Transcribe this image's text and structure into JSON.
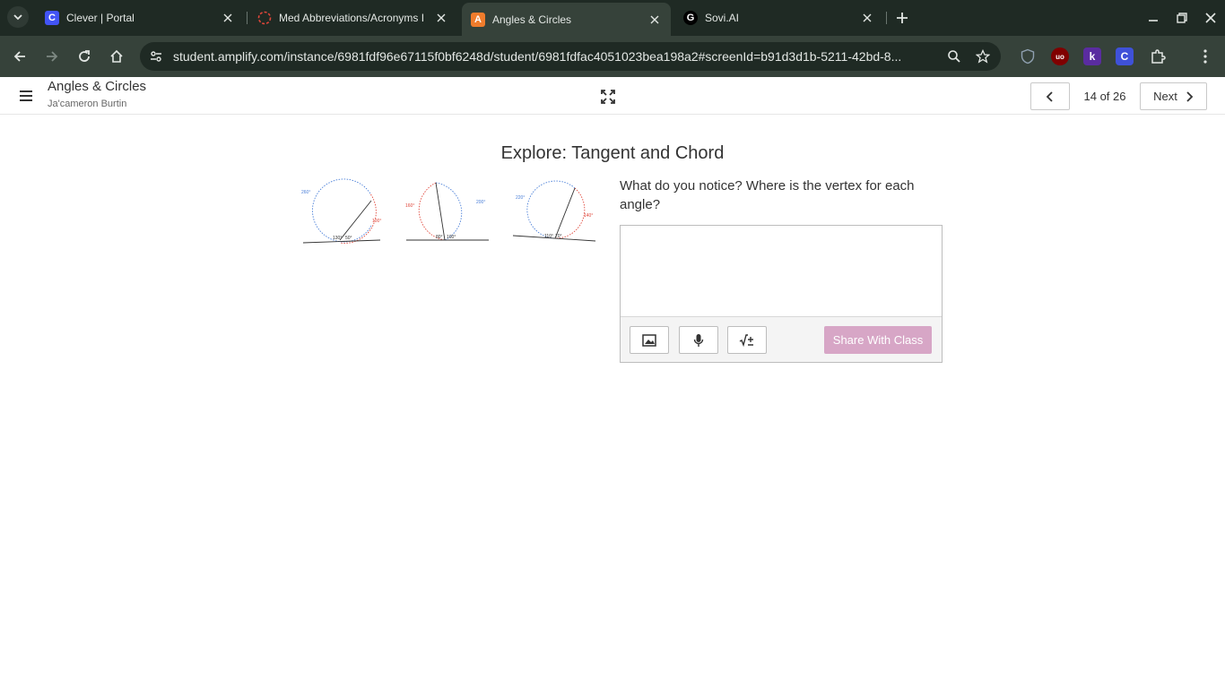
{
  "browser": {
    "tabs": [
      {
        "title": "Clever | Portal",
        "favicon": "clever-icon",
        "favicon_color": "#4254f5"
      },
      {
        "title": "Med Abbreviations/Acronyms I",
        "favicon": "loading-spinner-icon",
        "favicon_color": "#e0463a"
      },
      {
        "title": "Angles & Circles",
        "favicon": "amplify-icon",
        "favicon_color": "#f07c2c",
        "active": true
      },
      {
        "title": "Sovi.AI",
        "favicon": "sovi-icon",
        "favicon_color": "#ffffff"
      }
    ],
    "url": "student.amplify.com/instance/6981fdf96e67115f0bf6248d/student/6981fdfac4051023bea198a2#screenId=b91d3d1b-5211-42bd-8...",
    "extensions": [
      {
        "name": "ublock-icon",
        "text": "uo",
        "color": "#800000"
      },
      {
        "name": "kami-icon",
        "text": "k",
        "color": "#5a2ca0"
      },
      {
        "name": "clever-ext-icon",
        "text": "C",
        "color": "#3f51d8"
      }
    ]
  },
  "app": {
    "title": "Angles & Circles",
    "student_name": "Ja'cameron Burtin",
    "pagination": {
      "current": 14,
      "total": 26,
      "label": "14 of 26"
    },
    "next_label": "Next"
  },
  "content": {
    "screen_title": "Explore: Tangent and Chord",
    "prompt": "What do you notice? Where is the vertex for each angle?",
    "answer_placeholder": "",
    "share_label": "Share With Class",
    "figures": [
      {
        "arc_labels": [
          "260°",
          "100°"
        ],
        "angle_labels": [
          "130°",
          "50°"
        ]
      },
      {
        "arc_labels": [
          "160°",
          "200°"
        ],
        "angle_labels": [
          "80°",
          "100°"
        ]
      },
      {
        "arc_labels": [
          "220°",
          "140°"
        ],
        "angle_labels": [
          "110°",
          "70°"
        ]
      }
    ],
    "colors": {
      "major_arc": "#4a7fd8",
      "minor_arc": "#e0463a",
      "share_button": "#d7a6c6"
    }
  }
}
